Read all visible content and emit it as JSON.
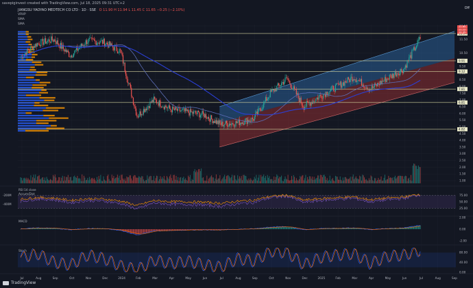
{
  "header": {
    "credit": "savepiginvest created with TradingView.com, Jul 18, 2025 09:31 UTC+2",
    "ticker": "JIANGSU YAOYAO MEDTECH CO LTD · 1D · SSE",
    "ohlc": "O 11.90 H 11.94 L 11.45 C 11.65 −0.25 (−2.10%)",
    "vrvp": "VRVP",
    "sma1": "SMA",
    "sma2": "SMA",
    "off_label": "Off"
  },
  "colors": {
    "bg": "#131722",
    "grid": "#1e222d",
    "up": "#26a69a",
    "down": "#ef5350",
    "vp_blue": "#2962ff",
    "vp_orange": "#ff9800",
    "sma_fast": "#5d6eb8",
    "sma_slow": "#2b3fd6",
    "channel_upper": "#2f6fb0",
    "channel_lower": "#a83236",
    "line_white": "#e0e3eb",
    "rsi": "#7e57c2",
    "accum": "#ff9800",
    "macd": "#2962ff",
    "signal": "#ff6d00",
    "stoch_k": "#2962ff",
    "stoch_d": "#ff6d00"
  },
  "chart_data": [
    {
      "type": "line",
      "title": "",
      "x": [
        "Jul",
        "Aug",
        "Sep",
        "Oct",
        "Nov",
        "Dec",
        "2024",
        "Feb",
        "Mar",
        "Apr",
        "May",
        "Jun",
        "Jul",
        "Aug",
        "Sep",
        "Oct",
        "Nov",
        "Dec",
        "2025",
        "Feb",
        "Mar",
        "Apr",
        "May",
        "Jun",
        "Jul",
        "Aug",
        "Sep"
      ],
      "series": [
        {
          "name": "Close",
          "values": [
            10.2,
            11.2,
            11.5,
            10.3,
            11.4,
            11.3,
            10.6,
            5.8,
            7.0,
            6.3,
            6.1,
            5.9,
            5.2,
            5.3,
            5.6,
            7.5,
            8.6,
            6.5,
            7.3,
            8.0,
            8.7,
            7.8,
            8.6,
            9.3,
            11.6
          ]
        }
      ],
      "yticks": [
        "12.50",
        "11.50",
        "10.50",
        "9.50",
        "9.00",
        "8.50",
        "8.00",
        "7.50",
        "7.00",
        "6.50",
        "6.00",
        "5.50",
        "5.00",
        "4.50",
        "4.00",
        "3.50",
        "3.00",
        "2.50",
        "2.00",
        "1.50",
        "1.00"
      ],
      "horizontal_levels": [
        "11.94",
        "9.91",
        "9.12",
        "7.81",
        "6.81",
        "4.82"
      ],
      "price_tags": [
        "11.65",
        "11.12",
        "10.35"
      ],
      "ylim": [
        0.8,
        12.6
      ]
    },
    {
      "type": "line",
      "title": "",
      "series": [
        {
          "name": "RSI",
          "values": [
            52,
            61,
            58,
            47,
            55,
            53,
            44,
            22,
            46,
            41,
            40,
            38,
            33,
            42,
            48,
            66,
            72,
            48,
            55,
            60,
            64,
            50,
            58,
            63,
            78
          ]
        }
      ],
      "yticks": [
        "75.00",
        "50.00",
        "25.00"
      ],
      "left_labels": [
        "-200M",
        "-400M"
      ],
      "legend": [
        "RSI 14 close",
        "Accum/Dist"
      ]
    },
    {
      "type": "bar",
      "title": "",
      "series": [
        {
          "name": "MACD",
          "values": [
            0.05,
            0.2,
            0.15,
            -0.1,
            0.1,
            0.08,
            -0.2,
            -0.9,
            -0.3,
            -0.2,
            -0.15,
            -0.1,
            -0.12,
            0.0,
            0.05,
            0.35,
            0.4,
            -0.1,
            0.1,
            0.15,
            0.2,
            -0.05,
            0.1,
            0.2,
            0.6
          ]
        }
      ],
      "yticks": [
        "2.00",
        "0.00",
        "-2.00"
      ],
      "legend": [
        "MACD"
      ]
    },
    {
      "type": "line",
      "title": "",
      "series": [
        {
          "name": "Stoch",
          "values": [
            60,
            75,
            40,
            30,
            70,
            55,
            25,
            10,
            50,
            35,
            45,
            30,
            20,
            55,
            45,
            85,
            80,
            30,
            60,
            70,
            75,
            35,
            65,
            70,
            90
          ]
        }
      ],
      "yticks": [
        "80.00",
        "40.00",
        "0.00"
      ],
      "legend": [
        "Stoch"
      ]
    }
  ],
  "branding": {
    "name": "TradingView"
  }
}
